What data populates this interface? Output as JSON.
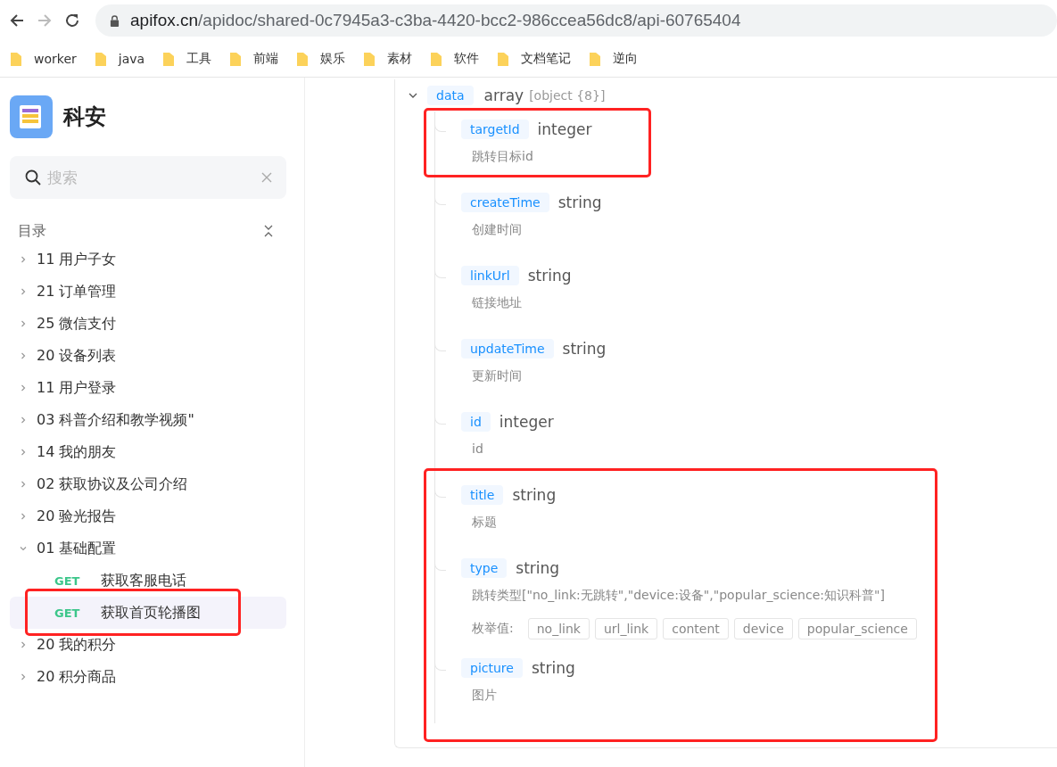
{
  "browser": {
    "url_host": "apifox.cn",
    "url_path": "/apidoc/shared-0c7945a3-c3ba-4420-bcc2-986ccea56dc8/api-60765404"
  },
  "bookmarks": [
    "worker",
    "java",
    "工具",
    "前端",
    "娱乐",
    "素材",
    "软件",
    "文档笔记",
    "逆向"
  ],
  "sidebar": {
    "project": "科安",
    "search": {
      "placeholder": "搜索"
    },
    "catalog_label": "目录",
    "items": [
      {
        "label": "11 用户子女",
        "expanded": false
      },
      {
        "label": "21 订单管理",
        "expanded": false
      },
      {
        "label": "25 微信支付",
        "expanded": false
      },
      {
        "label": "20 设备列表",
        "expanded": false
      },
      {
        "label": "11 用户登录",
        "expanded": false
      },
      {
        "label": "03 科普介绍和教学视频\"",
        "expanded": false
      },
      {
        "label": "14 我的朋友",
        "expanded": false
      },
      {
        "label": "02 获取协议及公司介绍",
        "expanded": false
      },
      {
        "label": "20 验光报告",
        "expanded": false
      },
      {
        "label": "01 基础配置",
        "expanded": true,
        "children": [
          {
            "method": "GET",
            "label": "获取客服电话",
            "selected": false,
            "highlighted": false
          },
          {
            "method": "GET",
            "label": "获取首页轮播图",
            "selected": true,
            "highlighted": true
          }
        ]
      },
      {
        "label": "20 我的积分",
        "expanded": false
      },
      {
        "label": "20 积分商品",
        "expanded": false
      }
    ]
  },
  "schema": {
    "name": "data",
    "type": "array",
    "type_detail": "[object {8}]",
    "expanded": true,
    "fields": [
      {
        "name": "targetId",
        "type": "integer",
        "description": "跳转目标id",
        "highlighted": true
      },
      {
        "name": "createTime",
        "type": "string",
        "description": "创建时间",
        "highlighted": false
      },
      {
        "name": "linkUrl",
        "type": "string",
        "description": "链接地址",
        "highlighted": false
      },
      {
        "name": "updateTime",
        "type": "string",
        "description": "更新时间",
        "highlighted": false
      },
      {
        "name": "id",
        "type": "integer",
        "description": "id",
        "highlighted": false
      },
      {
        "name": "title",
        "type": "string",
        "description": "标题",
        "highlighted": true
      },
      {
        "name": "type",
        "type": "string",
        "description": "跳转类型[\"no_link:无跳转\",\"device:设备\",\"popular_science:知识科普\"]",
        "highlighted": true,
        "enum_label": "枚举值:",
        "enum": [
          "no_link",
          "url_link",
          "content",
          "device",
          "popular_science"
        ]
      },
      {
        "name": "picture",
        "type": "string",
        "description": "图片",
        "highlighted": true
      }
    ]
  }
}
